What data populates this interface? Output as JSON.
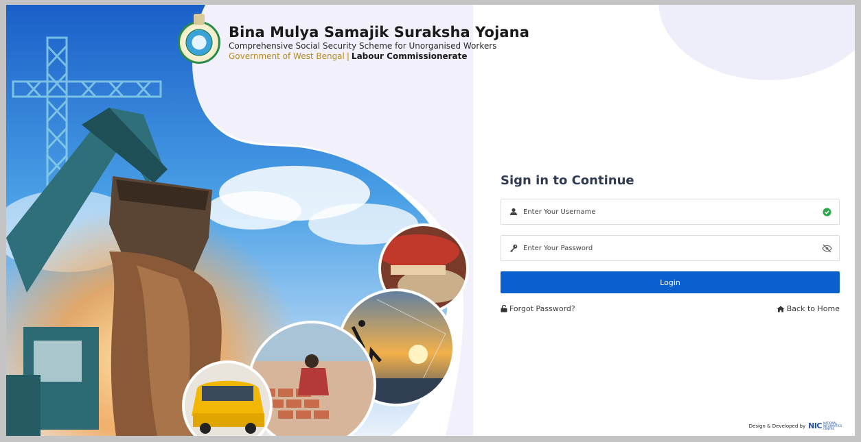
{
  "brand": {
    "title": "Bina Mulya Samajik Suraksha Yojana",
    "subtitle": "Comprehensive Social Security Scheme for Unorganised Workers",
    "government": "Government of West Bengal",
    "separator": "|",
    "department": "Labour Commissionerate",
    "logo_icon": "west-bengal-emblem-icon"
  },
  "signin": {
    "title": "Sign in to Continue",
    "username_placeholder": "Enter Your Username",
    "password_placeholder": "Enter Your Password",
    "username_icon": "user-icon",
    "password_icon": "key-icon",
    "username_status_icon": "check-circle-icon",
    "password_toggle_icon": "eye-slash-icon",
    "login_label": "Login",
    "forgot_label": "Forgot Password?",
    "forgot_icon": "unlock-icon",
    "home_label": "Back to Home",
    "home_icon": "home-icon"
  },
  "footer": {
    "credit": "Design & Developed by",
    "org_short": "NIC",
    "org_full": "NATIONAL INFORMATICS CENTRE"
  },
  "colors": {
    "primary": "#0b5fcf",
    "title": "#2f3b52",
    "gold": "#b48b20",
    "success": "#2aa84a",
    "blob": "#eeeefa"
  }
}
